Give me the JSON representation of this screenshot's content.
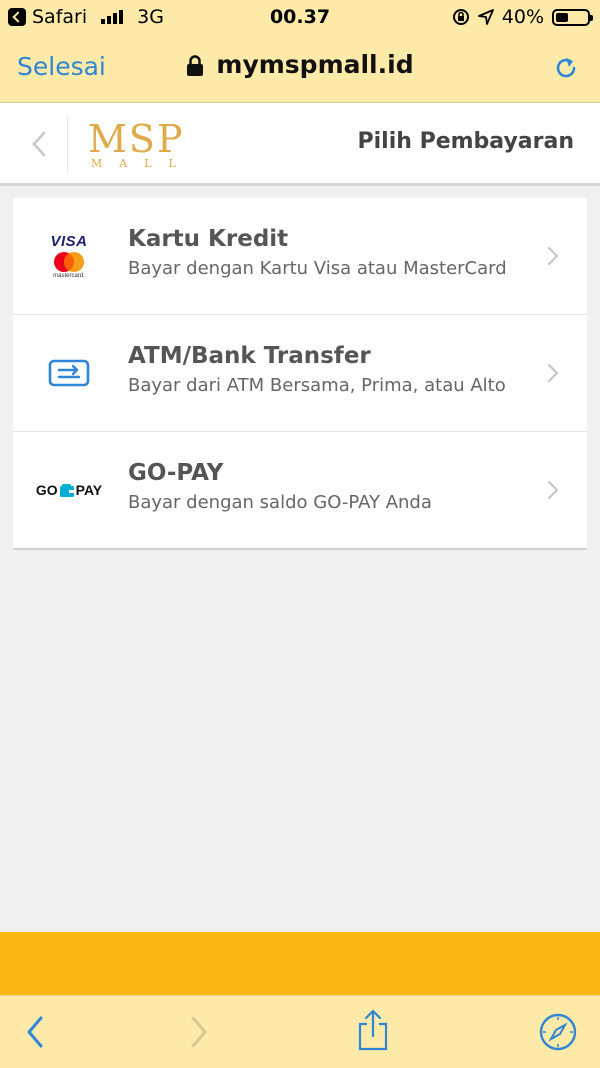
{
  "status_bar": {
    "back_app": "Safari",
    "network": "3G",
    "time": "00.37",
    "battery": "40%",
    "battery_level": 0.4
  },
  "browser": {
    "done_label": "Selesai",
    "url": "mymspmall.id"
  },
  "app_header": {
    "logo_main": "MSP",
    "logo_sub": "MALL",
    "title": "Pilih Pembayaran"
  },
  "payment_methods": [
    {
      "icon": "visa-mastercard-icon",
      "icon_text": "VISA",
      "icon_subtext": "mastercard.",
      "title": "Kartu Kredit",
      "subtitle": "Bayar dengan Kartu Visa atau MasterCard"
    },
    {
      "icon": "bank-transfer-icon",
      "title": "ATM/Bank Transfer",
      "subtitle": "Bayar dari ATM Bersama, Prima, atau Alto"
    },
    {
      "icon": "gopay-icon",
      "icon_text_left": "GO",
      "icon_text_right": "PAY",
      "title": "GO-PAY",
      "subtitle": "Bayar dengan saldo GO-PAY Anda"
    }
  ],
  "colors": {
    "safari_bar": "#fdeaa8",
    "accent_blue": "#2f86d6",
    "logo_gold": "#e0a94a",
    "band_yellow": "#fdb713"
  }
}
